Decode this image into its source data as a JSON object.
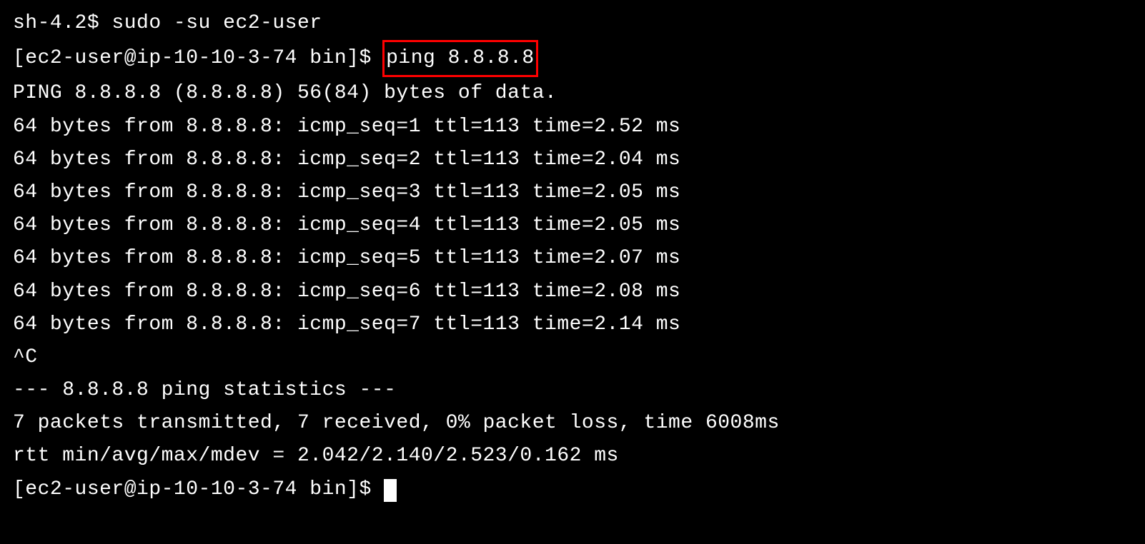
{
  "lines": {
    "l1_prompt": "sh-4.2$ ",
    "l1_cmd": "sudo -su ec2-user",
    "l2_prompt": "[ec2-user@ip-10-10-3-74 bin]$ ",
    "l2_cmd": "ping 8.8.8.8",
    "l3": "PING 8.8.8.8 (8.8.8.8) 56(84) bytes of data.",
    "l4": "64 bytes from 8.8.8.8: icmp_seq=1 ttl=113 time=2.52 ms",
    "l5": "64 bytes from 8.8.8.8: icmp_seq=2 ttl=113 time=2.04 ms",
    "l6": "64 bytes from 8.8.8.8: icmp_seq=3 ttl=113 time=2.05 ms",
    "l7": "64 bytes from 8.8.8.8: icmp_seq=4 ttl=113 time=2.05 ms",
    "l8": "64 bytes from 8.8.8.8: icmp_seq=5 ttl=113 time=2.07 ms",
    "l9": "64 bytes from 8.8.8.8: icmp_seq=6 ttl=113 time=2.08 ms",
    "l10": "64 bytes from 8.8.8.8: icmp_seq=7 ttl=113 time=2.14 ms",
    "l11": "^C",
    "l12": "--- 8.8.8.8 ping statistics ---",
    "l13": "7 packets transmitted, 7 received, 0% packet loss, time 6008ms",
    "l14": "rtt min/avg/max/mdev = 2.042/2.140/2.523/0.162 ms",
    "l15_prompt": "[ec2-user@ip-10-10-3-74 bin]$ "
  }
}
